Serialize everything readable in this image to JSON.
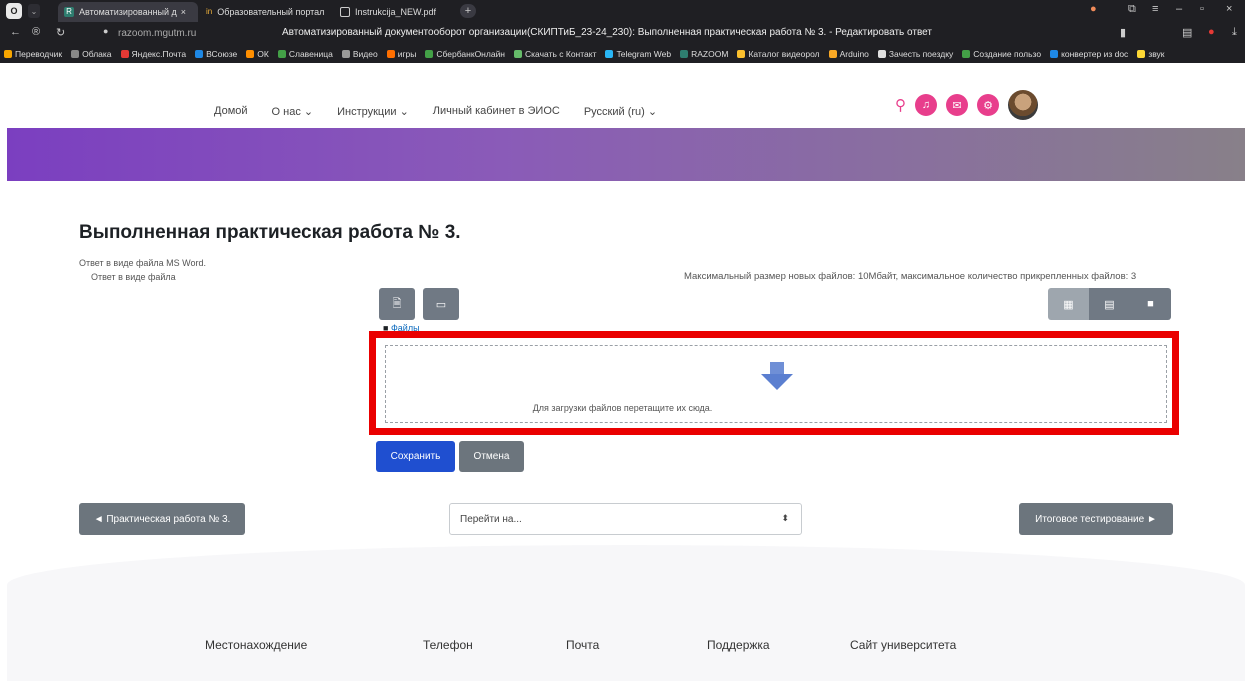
{
  "browser": {
    "tabs": [
      {
        "label": "Автоматизированный д",
        "active": true
      },
      {
        "label": "Образовательный портал",
        "active": false
      },
      {
        "label": "Instrukcija_NEW.pdf",
        "active": false
      }
    ],
    "address": "razoom.mgutm.ru",
    "page_title": "Автоматизированный документооборот организации(СКИПТиБ_23-24_230): Выполненная практическая работа № 3. - Редактировать ответ",
    "bookmarks": [
      "Переводчик",
      "Облака",
      "Яндекс.Почта",
      "ВСоюзе",
      "ОК",
      "Славеница",
      "Видео",
      "игры",
      "СбербанкОнлайн",
      "Скачать с Контакт",
      "Telegram Web",
      "RAZOOM",
      "Каталог видеорол",
      "Arduino",
      "Зачесть поездку",
      "Создание пользо",
      "конвертер из doc",
      "звук"
    ]
  },
  "nav": {
    "items": [
      "Домой",
      "О нас ⌄",
      "Инструкции ⌄",
      "Личный кабинет в ЭИОС",
      "Русский (ru) ⌄"
    ]
  },
  "main": {
    "title": "Выполненная практическая работа № 3.",
    "desc_line1": "Ответ в виде файла MS Word.",
    "desc_line2": "Ответ в виде файла",
    "max_info": "Максимальный размер новых файлов: 10Мбайт, максимальное количество прикрепленных файлов: 3",
    "crumb": "Файлы",
    "drop_text": "Для загрузки файлов перетащите их сюда.",
    "save_label": "Сохранить",
    "cancel_label": "Отмена"
  },
  "pager": {
    "prev_label": "◄ Практическая работа № 3.",
    "jump_placeholder": "Перейти на...",
    "next_label": "Итоговое тестирование ►"
  },
  "footer": {
    "cols": [
      "Местонахождение",
      "Телефон",
      "Почта",
      "Поддержка",
      "Сайт университета"
    ]
  },
  "colors": {
    "accent_pink": "#e83e8c",
    "primary": "#1f4fd0",
    "highlight_red": "#ea0000"
  }
}
